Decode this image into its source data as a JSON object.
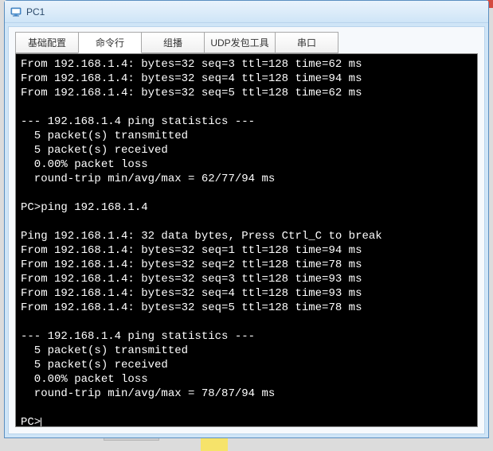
{
  "window": {
    "title": "PC1"
  },
  "tabs": [
    {
      "label": "基础配置"
    },
    {
      "label": "命令行"
    },
    {
      "label": "组播"
    },
    {
      "label": "UDP发包工具"
    },
    {
      "label": "串口"
    }
  ],
  "terminal": {
    "lines": [
      "From 192.168.1.4: bytes=32 seq=3 ttl=128 time=62 ms",
      "From 192.168.1.4: bytes=32 seq=4 ttl=128 time=94 ms",
      "From 192.168.1.4: bytes=32 seq=5 ttl=128 time=62 ms",
      "",
      "--- 192.168.1.4 ping statistics ---",
      "  5 packet(s) transmitted",
      "  5 packet(s) received",
      "  0.00% packet loss",
      "  round-trip min/avg/max = 62/77/94 ms",
      "",
      "PC>ping 192.168.1.4",
      "",
      "Ping 192.168.1.4: 32 data bytes, Press Ctrl_C to break",
      "From 192.168.1.4: bytes=32 seq=1 ttl=128 time=94 ms",
      "From 192.168.1.4: bytes=32 seq=2 ttl=128 time=78 ms",
      "From 192.168.1.4: bytes=32 seq=3 ttl=128 time=93 ms",
      "From 192.168.1.4: bytes=32 seq=4 ttl=128 time=93 ms",
      "From 192.168.1.4: bytes=32 seq=5 ttl=128 time=78 ms",
      "",
      "--- 192.168.1.4 ping statistics ---",
      "  5 packet(s) transmitted",
      "  5 packet(s) received",
      "  0.00% packet loss",
      "  round-trip min/avg/max = 78/87/94 ms",
      ""
    ],
    "prompt": "PC>"
  }
}
